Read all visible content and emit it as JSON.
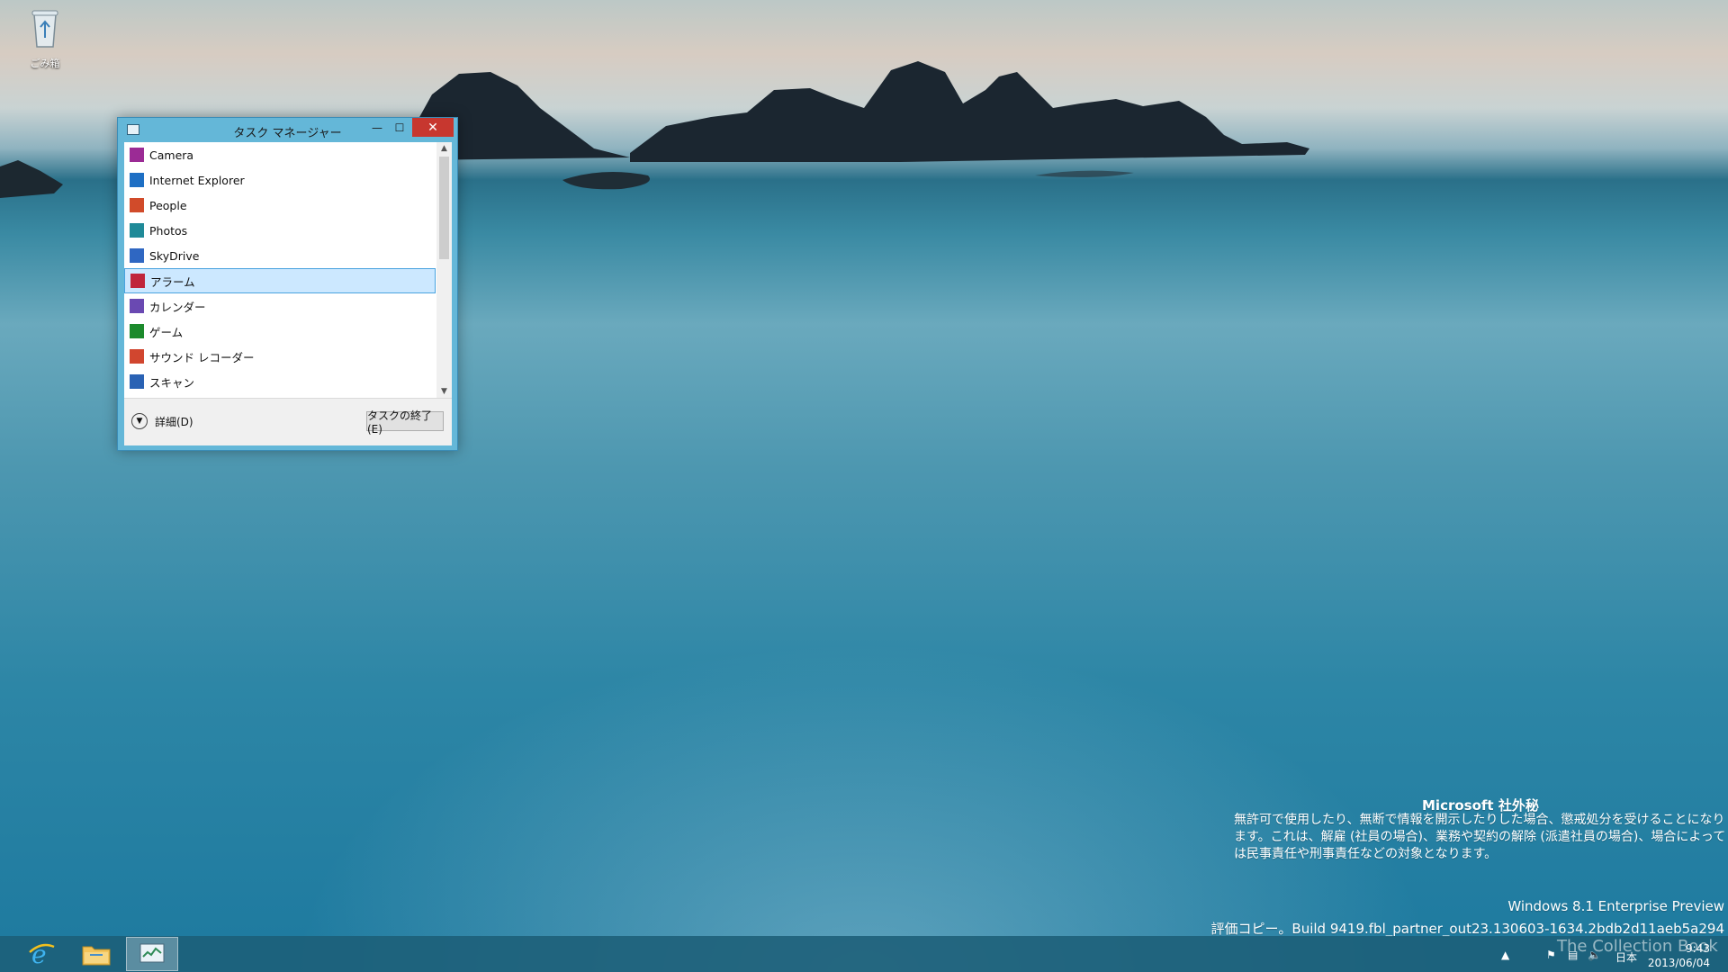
{
  "desktop": {
    "recycle_bin_label": "ごみ箱"
  },
  "task_manager": {
    "title": "タスク マネージャー",
    "buttons": {
      "minimize": "—",
      "maximize": "☐",
      "close": "✕"
    },
    "apps": [
      {
        "name": "Camera",
        "icon": "camera-icon",
        "color": "#9b2b95"
      },
      {
        "name": "Internet Explorer",
        "icon": "ie-icon",
        "color": "#1e6fc4"
      },
      {
        "name": "People",
        "icon": "people-icon",
        "color": "#d14b2a"
      },
      {
        "name": "Photos",
        "icon": "photos-icon",
        "color": "#1f8a98"
      },
      {
        "name": "SkyDrive",
        "icon": "skydrive-icon",
        "color": "#2f67c2"
      },
      {
        "name": "アラーム",
        "icon": "alarm-icon",
        "color": "#c0253b",
        "selected": true
      },
      {
        "name": "カレンダー",
        "icon": "calendar-icon",
        "color": "#6a49b2"
      },
      {
        "name": "ゲーム",
        "icon": "games-icon",
        "color": "#1c8a2c"
      },
      {
        "name": "サウンド レコーダー",
        "icon": "sound-recorder-icon",
        "color": "#d1462f"
      },
      {
        "name": "スキャン",
        "icon": "scan-icon",
        "color": "#2a62b4"
      }
    ],
    "details_label": "詳細(D)",
    "end_task_label": "タスクの終了(E)"
  },
  "watermark": {
    "title": "Microsoft 社外秘",
    "body": "無許可で使用したり、無断で情報を開示したりした場合、懲戒処分を受けることになります。これは、解雇 (社員の場合)、業務や契約の解除 (派遣社員の場合)、場合によっては民事責任や刑事責任などの対象となります。",
    "edition": "Windows 8.1 Enterprise Preview",
    "build": "評価コピー。Build 9419.fbl_partner_out23.130603-1634.2bdb2d11aeb5a294"
  },
  "taskbar": {
    "pinned": [
      {
        "name": "internet-explorer",
        "icon": "ie-icon"
      },
      {
        "name": "file-explorer",
        "icon": "folder-icon"
      },
      {
        "name": "task-manager",
        "icon": "task-manager-icon",
        "active": true
      }
    ],
    "language": "日本",
    "time": "9:43",
    "date": "2013/06/04",
    "overlay_text": "The Collection Book"
  }
}
